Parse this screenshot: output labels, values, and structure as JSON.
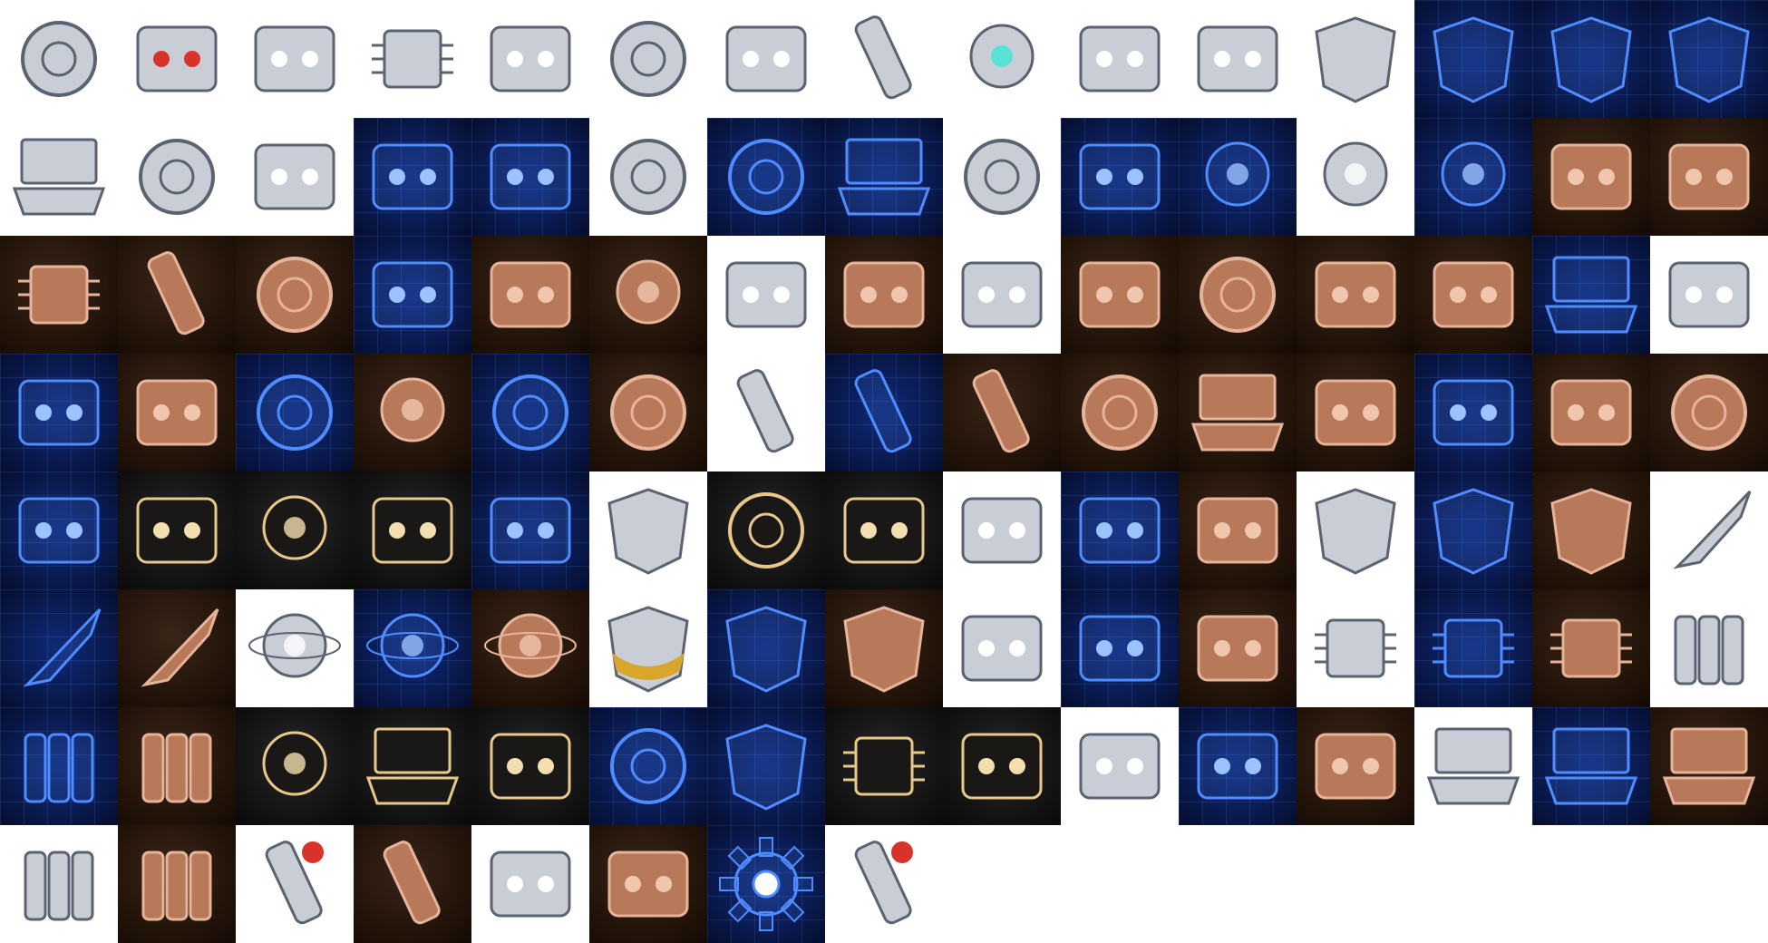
{
  "tiles": [
    {
      "style": "white",
      "icon": "round-device-icon"
    },
    {
      "style": "white",
      "icon": "red-button-pad-icon"
    },
    {
      "style": "white",
      "icon": "silver-scanner-icon"
    },
    {
      "style": "white",
      "icon": "green-chip-probe-icon"
    },
    {
      "style": "white",
      "icon": "monitor-box-icon"
    },
    {
      "style": "white",
      "icon": "syringe-injector-icon"
    },
    {
      "style": "white",
      "icon": "datapad-icon"
    },
    {
      "style": "white",
      "icon": "metal-cylinder-icon"
    },
    {
      "style": "white",
      "icon": "cyan-orb-icon"
    },
    {
      "style": "white",
      "icon": "bronze-blaster-icon"
    },
    {
      "style": "white",
      "icon": "coil-generator-icon"
    },
    {
      "style": "white",
      "icon": "armor-plate-icon"
    },
    {
      "style": "blueprint",
      "icon": "blueprint-hex-plate-icon"
    },
    {
      "style": "blueprint",
      "icon": "blueprint-curved-plate-icon"
    },
    {
      "style": "blueprint",
      "icon": "blueprint-wing-plate-icon"
    },
    {
      "style": "white",
      "icon": "laptop-icon"
    },
    {
      "style": "white",
      "icon": "metal-ring-pair-icon"
    },
    {
      "style": "white",
      "icon": "injector-gun-icon"
    },
    {
      "style": "blueprint",
      "icon": "blueprint-injector-icon"
    },
    {
      "style": "blueprint",
      "icon": "blueprint-panel-icon"
    },
    {
      "style": "white",
      "icon": "disc-module-icon"
    },
    {
      "style": "blueprint",
      "icon": "blueprint-disc-icon"
    },
    {
      "style": "blueprint",
      "icon": "blueprint-laptop-icon"
    },
    {
      "style": "white",
      "icon": "gold-ring-emblem-icon"
    },
    {
      "style": "blueprint",
      "icon": "blueprint-probe-icon"
    },
    {
      "style": "blueprint",
      "icon": "blueprint-orb-icon"
    },
    {
      "style": "white",
      "icon": "black-sphere-icon"
    },
    {
      "style": "blueprint",
      "icon": "blueprint-sphere-icon"
    },
    {
      "style": "bronze",
      "icon": "bronze-pad-icon"
    },
    {
      "style": "bronze",
      "icon": "bronze-scanner-icon"
    },
    {
      "style": "bronze",
      "icon": "bronze-chip-probe-icon"
    },
    {
      "style": "bronze",
      "icon": "bronze-cylinder-icon"
    },
    {
      "style": "bronze",
      "icon": "bronze-syringe-icon"
    },
    {
      "style": "blueprint",
      "icon": "blueprint-datapad-icon"
    },
    {
      "style": "bronze",
      "icon": "bronze-datapad-icon"
    },
    {
      "style": "bronze",
      "icon": "bronze-orb-icon"
    },
    {
      "style": "white",
      "icon": "medkit-box-icon"
    },
    {
      "style": "bronze",
      "icon": "bronze-medkit-icon"
    },
    {
      "style": "white",
      "icon": "remote-controller-icon"
    },
    {
      "style": "bronze",
      "icon": "bronze-controller-icon"
    },
    {
      "style": "bronze",
      "icon": "bronze-round-device-icon"
    },
    {
      "style": "bronze",
      "icon": "bronze-monitor-icon"
    },
    {
      "style": "bronze",
      "icon": "bronze-injector-gun-icon"
    },
    {
      "style": "blueprint",
      "icon": "blueprint-case-icon"
    },
    {
      "style": "white",
      "icon": "antenna-box-icon"
    },
    {
      "style": "blueprint",
      "icon": "blueprint-antenna-icon"
    },
    {
      "style": "bronze",
      "icon": "bronze-antenna-box-icon"
    },
    {
      "style": "blueprint",
      "icon": "blueprint-ring-icon"
    },
    {
      "style": "bronze",
      "icon": "bronze-sphere-icon"
    },
    {
      "style": "blueprint",
      "icon": "blueprint-emblem-icon"
    },
    {
      "style": "bronze",
      "icon": "bronze-emblem-icon"
    },
    {
      "style": "white",
      "icon": "glass-vial-icon"
    },
    {
      "style": "blueprint",
      "icon": "blueprint-vial-icon"
    },
    {
      "style": "bronze",
      "icon": "bronze-vial-icon"
    },
    {
      "style": "bronze",
      "icon": "bronze-disc-icon"
    },
    {
      "style": "bronze",
      "icon": "bronze-laptop-icon"
    },
    {
      "style": "bronze",
      "icon": "bronze-blaster-icon"
    },
    {
      "style": "blueprint",
      "icon": "blueprint-coil-icon"
    },
    {
      "style": "bronze",
      "icon": "bronze-coil-icon"
    },
    {
      "style": "bronze",
      "icon": "bronze-ring-icon"
    },
    {
      "style": "blueprint",
      "icon": "blueprint-blaster-icon"
    },
    {
      "style": "gold",
      "icon": "gold-scanner-icon"
    },
    {
      "style": "gold",
      "icon": "gold-orb-icon"
    },
    {
      "style": "gold",
      "icon": "gold-medkit-icon"
    },
    {
      "style": "blueprint",
      "icon": "blueprint-monitor-icon"
    },
    {
      "style": "white",
      "icon": "striped-armor-icon"
    },
    {
      "style": "gold",
      "icon": "gold-round-device-icon"
    },
    {
      "style": "gold",
      "icon": "gold-datapad-icon"
    },
    {
      "style": "white",
      "icon": "hammer-tool-icon"
    },
    {
      "style": "blueprint",
      "icon": "blueprint-hammer-icon"
    },
    {
      "style": "bronze",
      "icon": "bronze-hammer-icon"
    },
    {
      "style": "white",
      "icon": "chest-armor-icon"
    },
    {
      "style": "blueprint",
      "icon": "blueprint-armor-icon"
    },
    {
      "style": "bronze",
      "icon": "bronze-chest-armor-icon"
    },
    {
      "style": "white",
      "icon": "combat-knife-icon"
    },
    {
      "style": "blueprint",
      "icon": "blueprint-knife-icon"
    },
    {
      "style": "bronze",
      "icon": "bronze-knife-icon"
    },
    {
      "style": "white",
      "icon": "atom-globe-icon"
    },
    {
      "style": "blueprint",
      "icon": "blueprint-atom-icon"
    },
    {
      "style": "bronze",
      "icon": "bronze-atom-icon"
    },
    {
      "style": "white",
      "icon": "gold-visor-icon"
    },
    {
      "style": "blueprint",
      "icon": "blueprint-visor-icon"
    },
    {
      "style": "bronze",
      "icon": "bronze-visor-icon"
    },
    {
      "style": "white",
      "icon": "wrist-device-icon"
    },
    {
      "style": "blueprint",
      "icon": "blueprint-wrist-icon"
    },
    {
      "style": "bronze",
      "icon": "bronze-wrist-icon"
    },
    {
      "style": "white",
      "icon": "circuit-chip-icon"
    },
    {
      "style": "blueprint",
      "icon": "blueprint-chip-icon"
    },
    {
      "style": "bronze",
      "icon": "bronze-chip-icon"
    },
    {
      "style": "white",
      "icon": "battery-pack-icon"
    },
    {
      "style": "blueprint",
      "icon": "blueprint-battery-icon"
    },
    {
      "style": "bronze",
      "icon": "bronze-battery-icon"
    },
    {
      "style": "gold",
      "icon": "gold-sphere-icon"
    },
    {
      "style": "gold",
      "icon": "gold-laptop-icon"
    },
    {
      "style": "gold",
      "icon": "gold-coil-icon"
    },
    {
      "style": "blueprint",
      "icon": "blueprint-ring-pair-icon"
    },
    {
      "style": "blueprint",
      "icon": "blueprint-plate-icon"
    },
    {
      "style": "gold",
      "icon": "gold-chip-probe-icon"
    },
    {
      "style": "gold",
      "icon": "gold-blaster-icon"
    },
    {
      "style": "white",
      "icon": "claw-grip-icon"
    },
    {
      "style": "blueprint",
      "icon": "blueprint-claw-icon"
    },
    {
      "style": "bronze",
      "icon": "bronze-claw-icon"
    },
    {
      "style": "white",
      "icon": "holo-console-icon"
    },
    {
      "style": "blueprint",
      "icon": "blueprint-console-icon"
    },
    {
      "style": "bronze",
      "icon": "bronze-console-icon"
    },
    {
      "style": "white",
      "icon": "gold-canisters-icon"
    },
    {
      "style": "bronze",
      "icon": "bronze-canisters-icon"
    },
    {
      "style": "white",
      "icon": "red-flashlight-icon"
    },
    {
      "style": "bronze",
      "icon": "bronze-flashlight-icon"
    },
    {
      "style": "white",
      "icon": "horn-emitter-icon"
    },
    {
      "style": "bronze",
      "icon": "bronze-horn-emitter-icon"
    },
    {
      "style": "blueprint",
      "icon": "blueprint-gear-icon"
    },
    {
      "style": "white",
      "icon": "red-torch-icon"
    }
  ],
  "colors": {
    "blueprint_line": "#4f8cff",
    "blueprint_glow": "#9cc2ff",
    "bronze": "#b8795a",
    "bronze_dark": "#6b3f2a",
    "gold_line": "#e8c98a",
    "silver": "#c9ced6",
    "accent_red": "#d8332b",
    "accent_cyan": "#3fe6d6"
  }
}
